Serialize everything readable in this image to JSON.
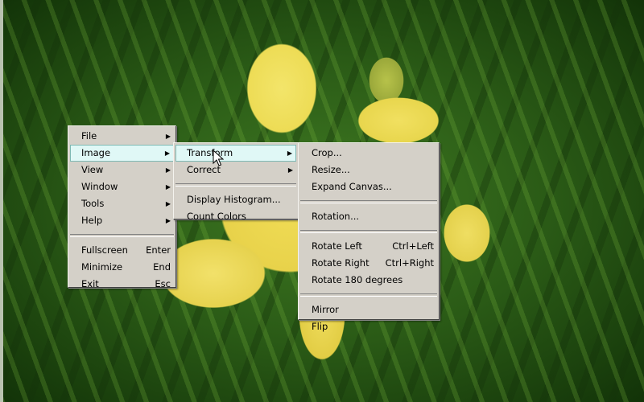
{
  "main_menu": {
    "items": [
      {
        "label": "File",
        "submenu": true
      },
      {
        "label": "Image",
        "submenu": true,
        "highlighted": true
      },
      {
        "label": "View",
        "submenu": true
      },
      {
        "label": "Window",
        "submenu": true
      },
      {
        "label": "Tools",
        "submenu": true
      },
      {
        "label": "Help",
        "submenu": true
      }
    ],
    "actions": [
      {
        "label": "Fullscreen",
        "shortcut": "Enter"
      },
      {
        "label": "Minimize",
        "shortcut": "End"
      },
      {
        "label": "Exit",
        "shortcut": "Esc"
      }
    ]
  },
  "image_menu": {
    "items": [
      {
        "label": "Transform",
        "submenu": true,
        "highlighted": true
      },
      {
        "label": "Correct",
        "submenu": true
      }
    ],
    "actions": [
      {
        "label": "Display Histogram..."
      },
      {
        "label": "Count Colors"
      }
    ]
  },
  "transform_menu": {
    "group1": [
      {
        "label": "Crop..."
      },
      {
        "label": "Resize..."
      },
      {
        "label": "Expand Canvas..."
      }
    ],
    "group2": [
      {
        "label": "Rotation..."
      }
    ],
    "group3": [
      {
        "label": "Rotate Left",
        "shortcut": "Ctrl+Left"
      },
      {
        "label": "Rotate Right",
        "shortcut": "Ctrl+Right"
      },
      {
        "label": "Rotate 180 degrees"
      }
    ],
    "group4": [
      {
        "label": "Mirror"
      },
      {
        "label": "Flip"
      }
    ]
  },
  "colors": {
    "menu_bg": "#d4d0c8",
    "highlight_bg": "#e0f8f6",
    "highlight_border": "#7fb9b4"
  }
}
